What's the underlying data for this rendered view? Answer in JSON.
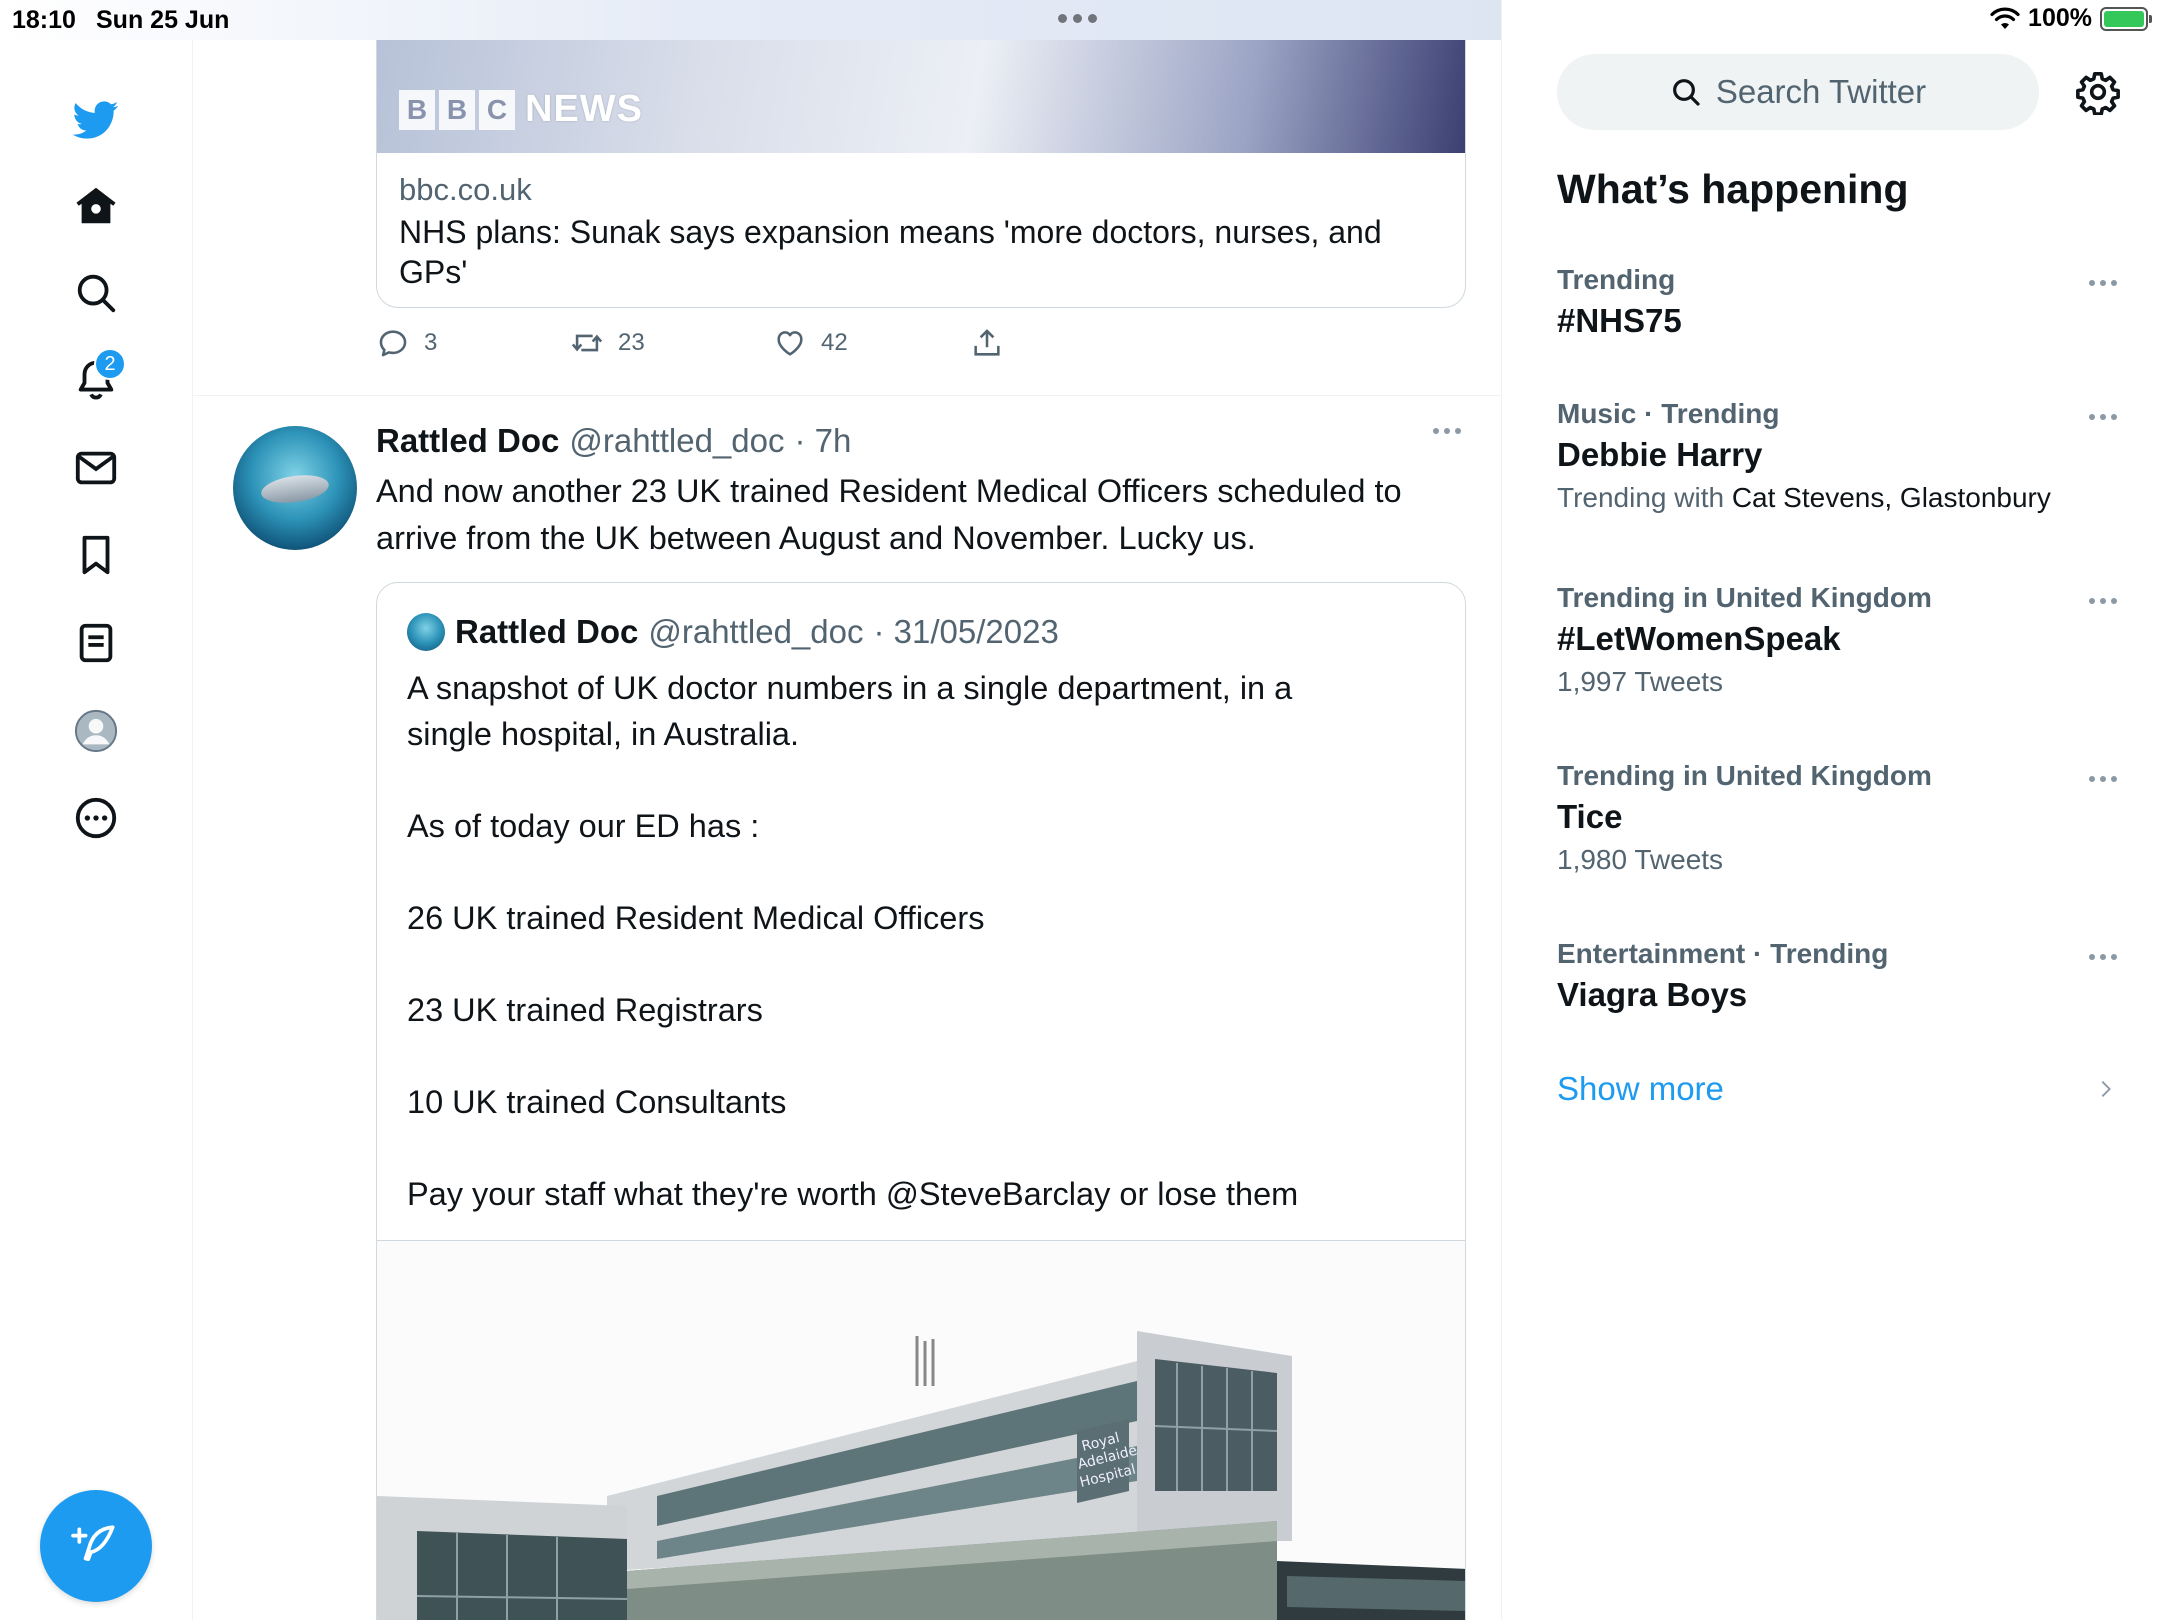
{
  "status_bar": {
    "time": "18:10",
    "date": "Sun 25 Jun",
    "battery": "100%",
    "battery_level": 1.0
  },
  "nav": {
    "notifications_badge": "2"
  },
  "link_card": {
    "logo_letters": [
      "B",
      "B",
      "C"
    ],
    "logo_word": "NEWS",
    "domain": "bbc.co.uk",
    "title": "NHS plans: Sunak says expansion means 'more doctors, nurses, and GPs'"
  },
  "card_actions": {
    "replies": "3",
    "retweets": "23",
    "likes": "42"
  },
  "tweet": {
    "name": "Rattled Doc",
    "handle": "@rahttled_doc",
    "time": "· 7h",
    "text": "And now another 23 UK trained Resident Medical Officers scheduled to arrive from the UK between August and November. Lucky us."
  },
  "quote": {
    "name": "Rattled Doc",
    "handle": "@rahttled_doc",
    "date": "· 31/05/2023",
    "lines": [
      "A snapshot of UK doctor numbers in a single department, in a single hospital, in Australia.",
      "As of today our ED has :",
      "26 UK trained Resident Medical Officers",
      "23 UK trained Registrars",
      "10 UK trained Consultants",
      "Pay your staff what they're worth @SteveBarclay or lose them"
    ],
    "photo_sign": [
      "Royal",
      "Adelaide",
      "Hospital"
    ]
  },
  "sidebar": {
    "search_placeholder": "Search Twitter",
    "section_title": "What’s happening",
    "trends": [
      {
        "category": "Trending",
        "name": "#NHS75",
        "sub": ""
      },
      {
        "category": "Music · Trending",
        "name": "Debbie Harry",
        "sub_prefix": "Trending with ",
        "sub_names": "Cat Stevens, Glastonbury"
      },
      {
        "category": "Trending in United Kingdom",
        "name": "#LetWomenSpeak",
        "sub": "1,997 Tweets"
      },
      {
        "category": "Trending in United Kingdom",
        "name": "Tice",
        "sub": "1,980 Tweets"
      },
      {
        "category": "Entertainment · Trending",
        "name": "Viagra Boys",
        "sub": ""
      }
    ],
    "show_more": "Show more"
  },
  "colors": {
    "accent": "#1d9bf0",
    "text_primary": "#0f1419",
    "text_secondary": "#536471",
    "border": "#cfd9de"
  }
}
